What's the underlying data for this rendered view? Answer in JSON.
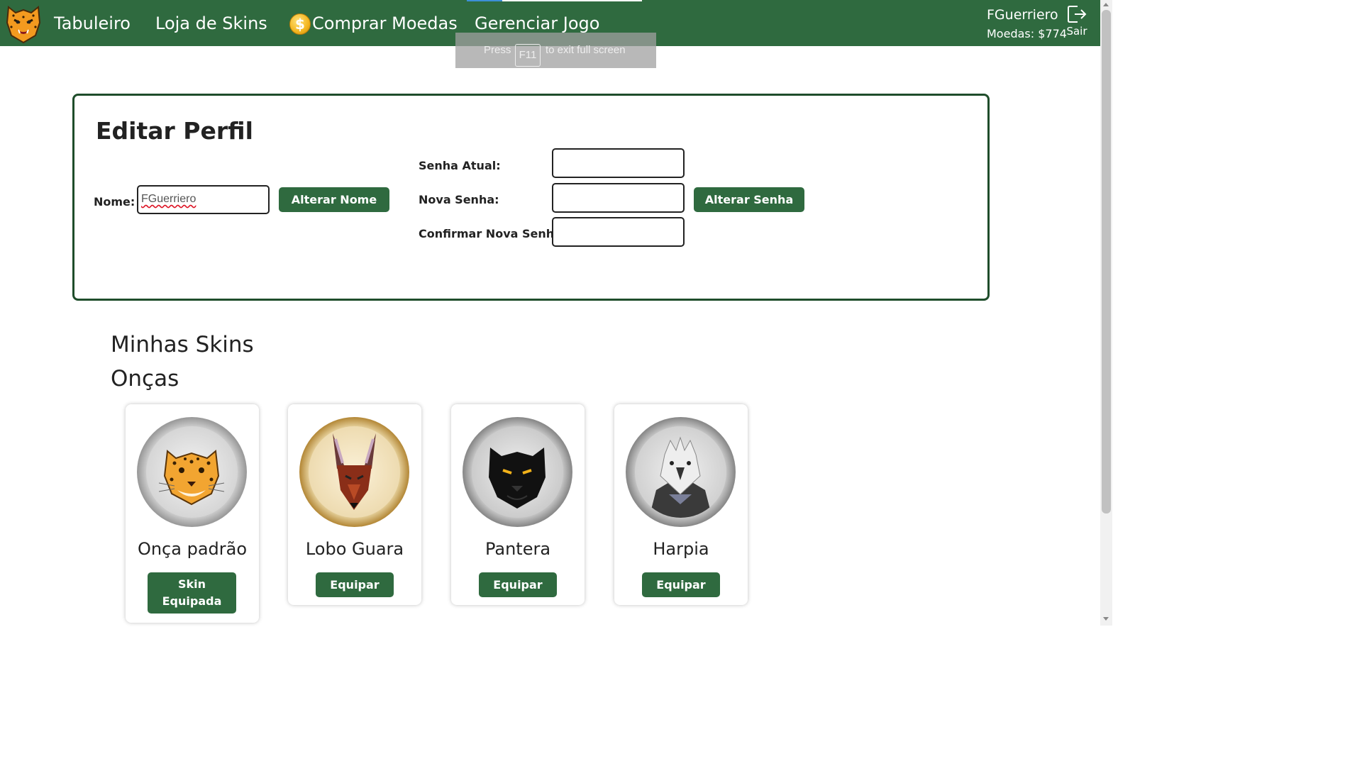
{
  "nav": {
    "links": [
      "Tabuleiro",
      "Loja de Skins",
      "Comprar Moedas",
      "Gerenciar Jogo"
    ],
    "coin_symbol": "$",
    "user_name": "FGuerriero",
    "coins": "Moedas: $774",
    "logout": "Sair"
  },
  "fullscreen_toast": {
    "before": "Press",
    "key": "F11",
    "after": "to exit full screen"
  },
  "profile": {
    "title": "Editar Perfil",
    "name_label": "Nome:",
    "name_value": "FGuerriero",
    "change_name_button": "Alterar Nome",
    "current_password_label": "Senha Atual:",
    "new_password_label": "Nova Senha:",
    "confirm_password_label": "Confirmar Nova Senha:",
    "change_password_button": "Alterar Senha"
  },
  "skins": {
    "title": "Minhas Skins",
    "category": "Onças",
    "items": [
      {
        "name": "Onça padrão",
        "button": "Skin Equipada",
        "icon": "jaguar-icon"
      },
      {
        "name": "Lobo Guara",
        "button": "Equipar",
        "icon": "maned-wolf-icon"
      },
      {
        "name": "Pantera",
        "button": "Equipar",
        "icon": "panther-icon"
      },
      {
        "name": "Harpia",
        "button": "Equipar",
        "icon": "harpy-eagle-icon"
      }
    ]
  },
  "colors": {
    "nav_bg": "#2f6a3f",
    "button_bg": "#2f6a3f",
    "card_border": "#1f4d2b"
  }
}
